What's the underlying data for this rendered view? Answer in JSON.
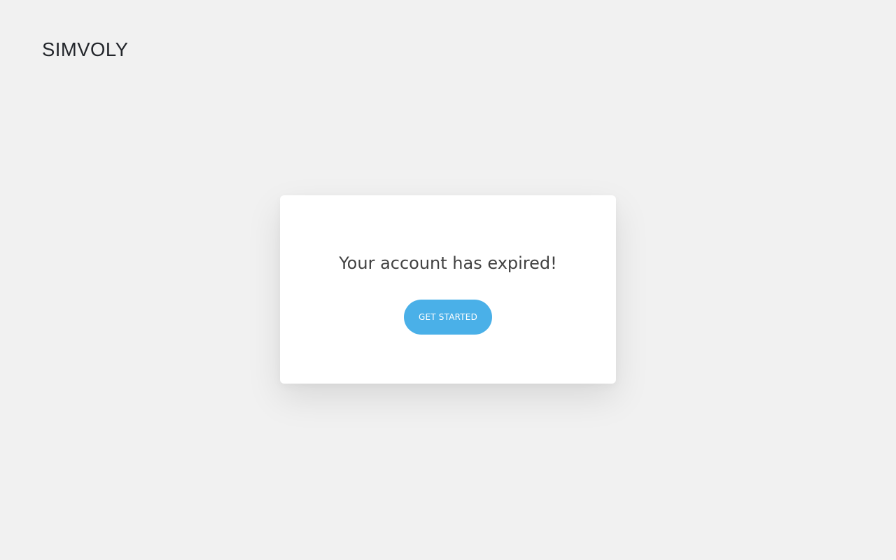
{
  "brand": {
    "logo_text": "SIMVOLY",
    "logo_color": "#23262b"
  },
  "modal": {
    "title": "Your account has expired!",
    "cta_label": "GET STARTED",
    "cta_color": "#4ab0e8"
  },
  "colors": {
    "page_background": "#f1f1f1",
    "card_background": "#ffffff",
    "title_text": "#424242"
  }
}
